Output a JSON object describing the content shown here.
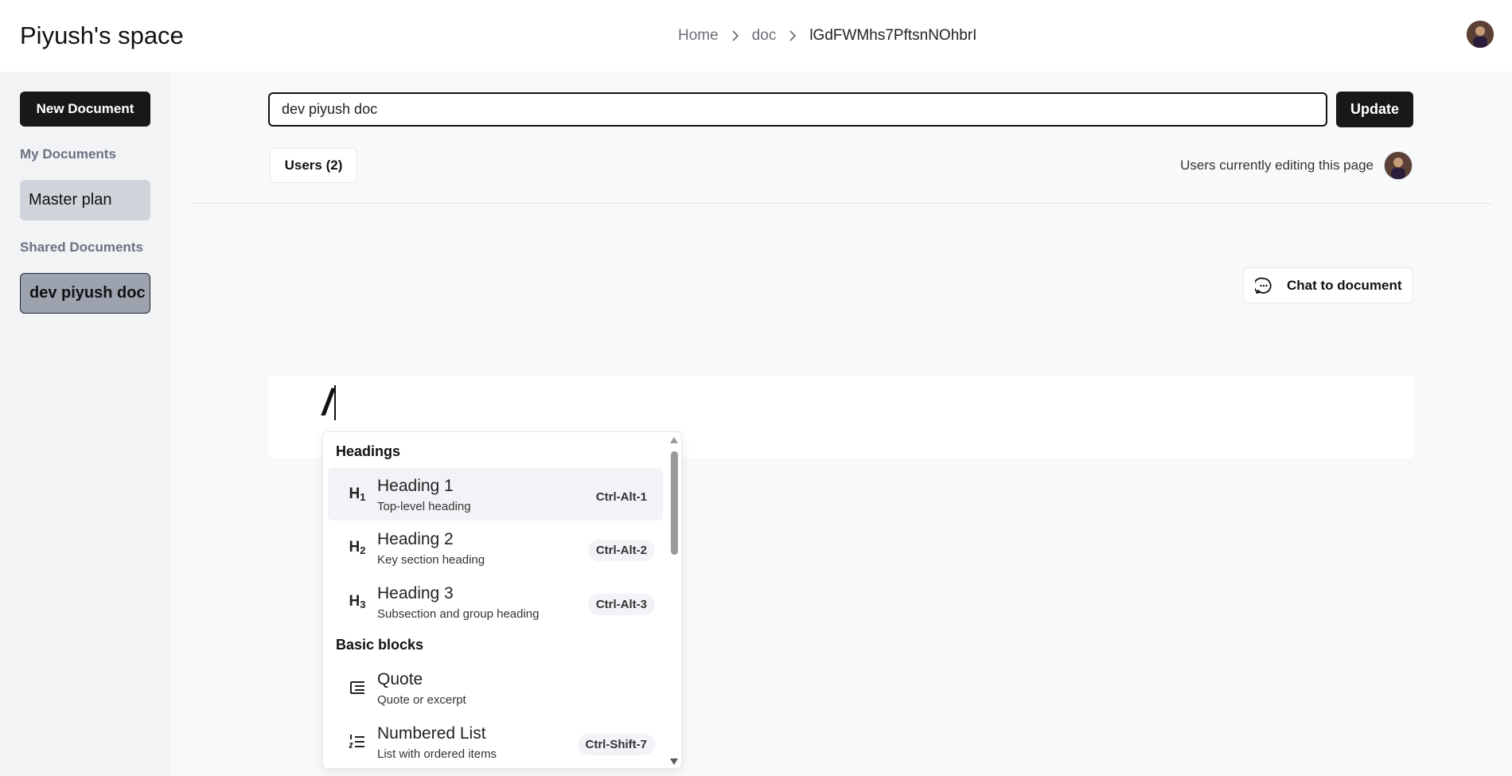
{
  "app": {
    "title": "Piyush's space"
  },
  "breadcrumb": {
    "items": [
      "Home",
      "doc",
      "lGdFWMhs7PftsnNOhbrI"
    ]
  },
  "sidebar": {
    "new_document_label": "New Document",
    "my_documents_label": "My Documents",
    "my_documents": [
      "Master plan"
    ],
    "shared_documents_label": "Shared Documents",
    "shared_documents": [
      "dev piyush doc"
    ]
  },
  "document": {
    "title_value": "dev piyush doc",
    "update_label": "Update",
    "users_label": "Users (2)",
    "editing_label": "Users currently editing this page",
    "chat_label": "Chat to document",
    "editor_text": "/"
  },
  "slash_menu": {
    "groups": [
      "Headings",
      "Basic blocks"
    ],
    "items": [
      {
        "icon": "H1",
        "icon_name": "heading-1-icon",
        "title": "Heading 1",
        "subtitle": "Top-level heading",
        "shortcut": "Ctrl-Alt-1"
      },
      {
        "icon": "H2",
        "icon_name": "heading-2-icon",
        "title": "Heading 2",
        "subtitle": "Key section heading",
        "shortcut": "Ctrl-Alt-2"
      },
      {
        "icon": "H3",
        "icon_name": "heading-3-icon",
        "title": "Heading 3",
        "subtitle": "Subsection and group heading",
        "shortcut": "Ctrl-Alt-3"
      },
      {
        "icon": "quote",
        "icon_name": "quote-icon",
        "title": "Quote",
        "subtitle": "Quote or excerpt",
        "shortcut": ""
      },
      {
        "icon": "numbered-list",
        "icon_name": "numbered-list-icon",
        "title": "Numbered List",
        "subtitle": "List with ordered items",
        "shortcut": "Ctrl-Shift-7"
      }
    ]
  },
  "colors": {
    "primary": "#18181b",
    "sidebar_bg": "#f2f3f5",
    "page_bg": "#f8f9fb",
    "highlight": "#f1f3f6"
  }
}
